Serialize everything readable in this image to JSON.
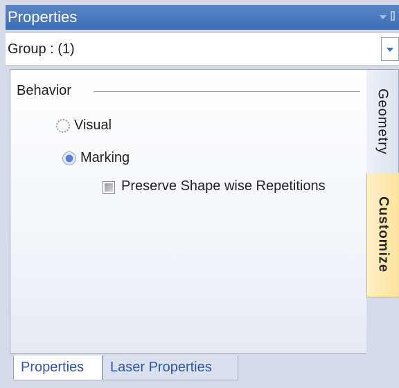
{
  "window": {
    "title": "Properties",
    "dropdown_icon": "chevron-down-icon",
    "pin_icon": "pin-icon"
  },
  "object_selector": {
    "value": "Group : (1)"
  },
  "behavior": {
    "group_label": "Behavior",
    "options": [
      {
        "label": "Visual",
        "selected": false
      },
      {
        "label": "Marking",
        "selected": true
      }
    ],
    "preserve_checkbox": {
      "label": "Preserve Shape wise Repetitions",
      "checked": "indeterminate"
    }
  },
  "side_tabs": [
    {
      "label": "Geometry",
      "active": false
    },
    {
      "label": "Customize",
      "active": true
    }
  ],
  "bottom_tabs": [
    {
      "label": "Properties",
      "active": true
    },
    {
      "label": "Laser Properties",
      "active": false
    }
  ],
  "colors": {
    "title_bar": "#3c6db4",
    "active_side_tab": "#fbe29c",
    "tab_text": "#2d55a0"
  }
}
